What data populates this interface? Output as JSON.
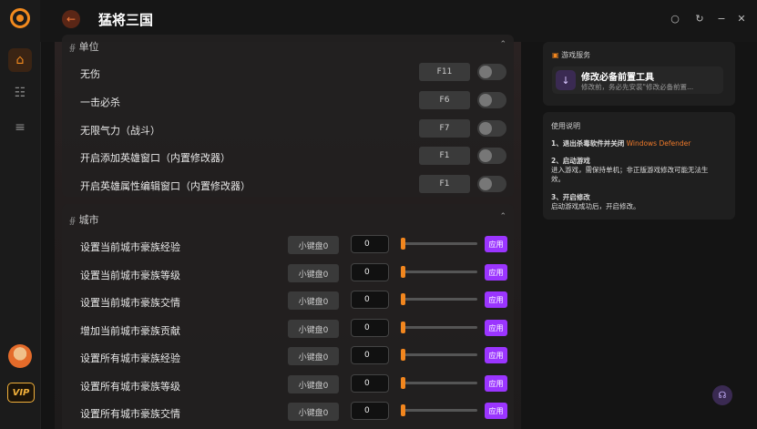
{
  "app": {
    "title": "猛将三国",
    "vip": "VIP"
  },
  "section1": {
    "header": "单位",
    "rows": [
      {
        "label": "无伤",
        "hotkey": "F11"
      },
      {
        "label": "一击必杀",
        "hotkey": "F6"
      },
      {
        "label": "无限气力（战斗）",
        "hotkey": "F7"
      },
      {
        "label": "开启添加英雄窗口（内置修改器）",
        "hotkey": "F1"
      },
      {
        "label": "开启英雄属性编辑窗口（内置修改器）",
        "hotkey": "F1"
      }
    ]
  },
  "section2": {
    "header": "城市",
    "rows": [
      {
        "label": "设置当前城市豪族经验",
        "numpad": "小键盘0",
        "value": "0",
        "apply": "应用"
      },
      {
        "label": "设置当前城市豪族等级",
        "numpad": "小键盘0",
        "value": "0",
        "apply": "应用"
      },
      {
        "label": "设置当前城市豪族交情",
        "numpad": "小键盘0",
        "value": "0",
        "apply": "应用"
      },
      {
        "label": "增加当前城市豪族贡献",
        "numpad": "小键盘0",
        "value": "0",
        "apply": "应用"
      },
      {
        "label": "设置所有城市豪族经验",
        "numpad": "小键盘0",
        "value": "0",
        "apply": "应用"
      },
      {
        "label": "设置所有城市豪族等级",
        "numpad": "小键盘0",
        "value": "0",
        "apply": "应用"
      },
      {
        "label": "设置所有城市豪族交情",
        "numpad": "小键盘0",
        "value": "0",
        "apply": "应用"
      }
    ]
  },
  "game_service": {
    "header": "游戏服务",
    "tool_name": "修改必备前置工具",
    "tool_desc": "修改前，务必先安装\"修改必备前置..."
  },
  "instructions": {
    "header": "使用说明",
    "step1_title": "1、退出杀毒软件并关闭",
    "step1_highlight": "Windows Defender",
    "step2_title": "2、启动游戏",
    "step2_text_a": "进入游戏，需保持单机；非正版游戏修改可能无法生",
    "step2_text_b": "效。",
    "step3_title": "3、开启修改",
    "step3_text": "启动游戏成功后，开启修改。"
  },
  "colors": {
    "accent": "#f2861e",
    "apply": "#9b35ff",
    "highlight": "#f07a2a"
  },
  "icons": [
    "logo-icon",
    "home-icon",
    "gamepad-icon",
    "stack-icon",
    "back-arrow-icon",
    "shirt-icon",
    "sync-icon",
    "minimize-icon",
    "close-icon",
    "box-icon",
    "download-icon",
    "grid-icon",
    "chevron-up-icon",
    "headset-icon"
  ]
}
